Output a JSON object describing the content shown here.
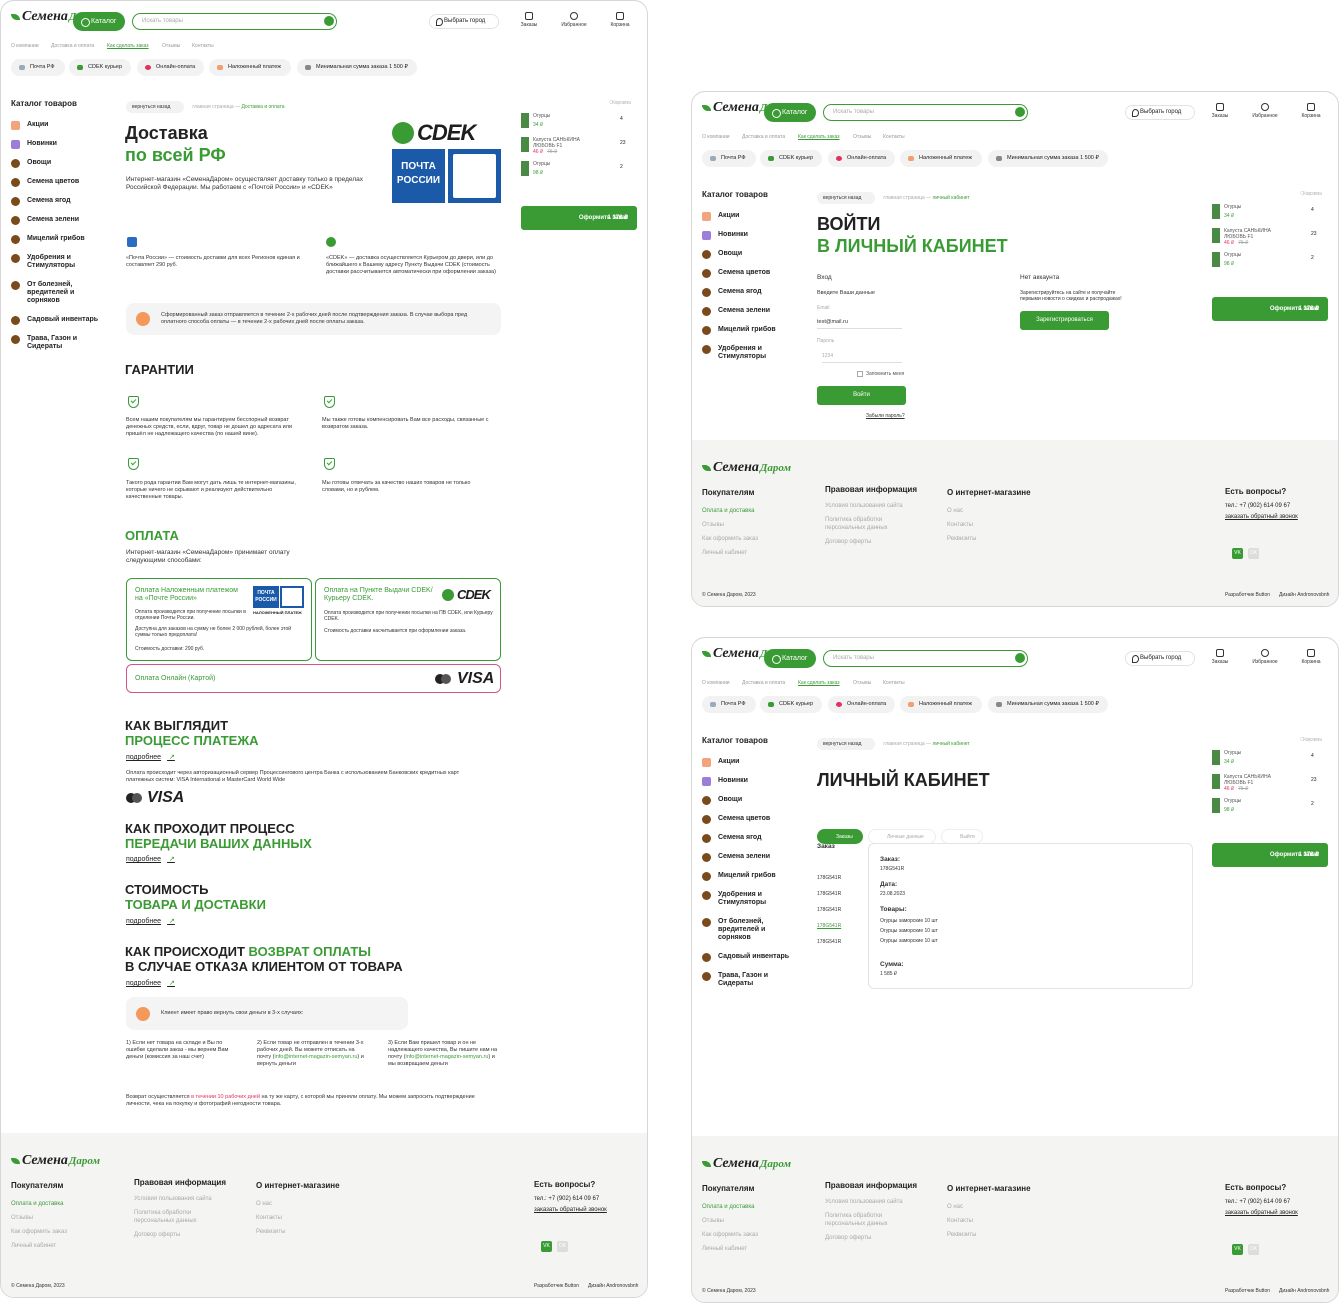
{
  "header": {
    "logo_main": "Семена",
    "logo_sub": "Даром",
    "catalog": "Каталог",
    "search_placeholder": "Искать товары",
    "city": "Выбрать город",
    "orders": "Заказы",
    "favorites": "Избранное",
    "cart": "Корзина"
  },
  "nav": [
    "О компании",
    "Доставка и оплата",
    "Как сделать заказ",
    "Отзывы",
    "Контакты"
  ],
  "pills": [
    "Почта РФ",
    "CDEK курьер",
    "Онлайн-оплата",
    "Наложенный платеж",
    "Минимальная сумма заказа 1 500 ₽"
  ],
  "sidebar": {
    "title": "Каталог товаров",
    "items": [
      "Акции",
      "Новинки",
      "Овощи",
      "Семена цветов",
      "Семена ягод",
      "Семена зелени",
      "Мицелий грибов",
      "Удобрения и Стимуляторы",
      "От болезней, вредителей и сорняков",
      "Садовый инвентарь",
      "Трава, Газон и Сидераты"
    ]
  },
  "cart": {
    "title": "Корзина",
    "clear": "Очистить",
    "items": [
      {
        "name": "Огурцы",
        "price": "34 ₽",
        "qty": "4"
      },
      {
        "name": "Капуста САНЬКИНА ЛЮБОВЬ F1",
        "price": "46 ₽",
        "old": "75 ₽",
        "qty": "23"
      },
      {
        "name": "Огурцы",
        "price": "98 ₽",
        "qty": "2"
      }
    ],
    "order": "Оформить заказ",
    "total": "1 378 ₽"
  },
  "crumbs": {
    "back": "вернуться назад",
    "home": "главная страница",
    "delivery": "Доставка и оплата",
    "cabinet": "личный кабинет"
  },
  "delivery": {
    "title1": "Доставка",
    "title2": "по всей РФ",
    "intro": "Интернет-магазин «СеменаДаром» осуществляет доставку только в пределах Российской Федерации. Мы работаем с «Почтой России» и «CDEK»",
    "cdek_logo": "CDEK",
    "pochta_logo": "ПОЧТА РОССИИ",
    "pochta_text": "«Почта России» — стоимость доставки для всех Регионов единая и составляет 290 руб.",
    "cdek_text": "«CDEK» — доставка осуществляется Курьером до двери, или до ближайшего к Вашему адресу Пункту Выдачи CDEK (стоимость доставки рассчитывается автоматически при оформлении заказа)",
    "note": "Сформированный заказ отправляется в течение 2-х рабочих дней после подтверждения заказа. В случае выбора пред оплатного способа оплаты — в течение 2-х рабочих дней после оплаты заказа."
  },
  "guarantees": {
    "title": "ГАРАНТИИ",
    "items": [
      "Всем нашим покупателям мы гарантируем бесспорный возврат денежных средств, если, вдруг, товар не дошел до адресата или пришёл не надлежащего качества (по нашей вине).",
      "Мы также готовы компенсировать Вам все расходы, связанные с возвратом заказа.",
      "Такого рода гарантии Вам могут дать лишь те интернет-магазины, которые ничего не скрывают и реализуют действительно качественные товары.",
      "Мы готовы отвечать за качество наших товаров не только словами, но и рублем."
    ]
  },
  "payment": {
    "title": "ОПЛАТА",
    "intro": "Интернет-магазин «СеменаДаром» принимает оплату следующими способами:",
    "card1_title": "Оплата Наложенным платежом на «Почте России»",
    "card1_badge": "НАЛОЖЕННЫЙ ПЛАТЕЖ",
    "card1_p1": "Оплата производится при получение посылки в отделении Почты России.",
    "card1_p2": "Доступна для заказов на сумму не более 2 000 рублей, более этой суммы только предоплата!",
    "card1_cost": "Стоимость доставки: 290 руб.",
    "card2_title": "Оплата на Пункте Выдачи CDEK/Курьеру CDEK.",
    "card2_p1": "Оплата производится при получении посылки на ПВ CDEK, или Курьеру CDEK.",
    "card2_p2": "Стоимость доставки насчитывается при оформлении заказа.",
    "card3_title": "Оплата Онлайн (Картой)",
    "visa": "VISA"
  },
  "process": {
    "t1a": "КАК ВЫГЛЯДИТ",
    "t1b": "ПРОЦЕСС ПЛАТЕЖА",
    "more": "подробнее",
    "text": "Оплата происходит через авторизационный сервер Процессингового центра Банка с использованием Банковских кредитных карт платежных систем: VISA International и MasterCard World Wide",
    "t2a": "КАК ПРОХОДИТ ПРОЦЕСС",
    "t2b": "ПЕРЕДАЧИ ВАШИХ ДАННЫХ",
    "t3a": "СТОИМОСТЬ",
    "t3b": "ТОВАРА И ДОСТАВКИ",
    "t4a": "КАК ПРОИСХОДИТ ",
    "t4g": "ВОЗВРАТ ОПЛАТЫ",
    "t4b": "В СЛУЧАЕ ОТКАЗА КЛИЕНТОМ ОТ ТОВАРА",
    "note": "Клиент имеет право вернуть свои деньги в 3-х случаях:",
    "c1": "1) Если нет товара на складе и Вы по ошибке сделали заказ - мы вернем Вам деньги (комиссия за наш счет)",
    "c2a": "2) Если товар не отправлен в течении 3-х рабочих дней. Вы можете отписать на почту (",
    "c2l": "info@internet-magazin-semyan.ru",
    "c2b": ") и вернуть деньги",
    "c3a": "3) Если Вам пришел товар и он не надлежащего качества, Вы пишите нам на почту (",
    "c3l": "info@internet-magazin-semyan.ru",
    "c3b": ") и мы возвращаем деньги",
    "fin_a": "Возврат осуществляется ",
    "fin_r": "в течении 10 рабочих дней",
    "fin_b": " на ту же карту, с которой мы приняли оплату. Мы можем запросить подтверждение личности, чека на покупку и фотографий негодности товара."
  },
  "footer": {
    "c1_title": "Покупателям",
    "c1": [
      "Оплата и доставка",
      "Отзывы",
      "Как оформить заказ",
      "Личный кабинет"
    ],
    "c2_title": "Правовая информация",
    "c2": [
      "Условия пользования сайта",
      "Политика обработки персональных данных",
      "Договор оферты"
    ],
    "c3_title": "О интернет-магазине",
    "c3": [
      "О нас",
      "Контакты",
      "Реквизиты"
    ],
    "c4_title": "Есть вопросы?",
    "phone": "тел.: +7 (902) 614 09 67",
    "callback": "заказать обратный звонок",
    "vk": "VK",
    "ok": "OK",
    "copy": "© Семена Даром, 2023",
    "dev": "Разработчик Button",
    "design": "Дизайн Andronovsbnh"
  },
  "login": {
    "t1": "ВОЙТИ",
    "t2": "В ЛИЧНЫЙ КАБИНЕТ",
    "enter": "Вход",
    "hint": "Введите Ваши данные",
    "email_label": "Email",
    "email": "test@mail.ru",
    "pass_label": "Пароль",
    "pass": "1234",
    "remember": "Запомнить меня",
    "btn": "Войти",
    "forgot": "Забыли пароль?",
    "no_acc": "Нет аккаунта",
    "reg_text": "Зарегистрируйтесь на сайте и получайте первыми новости о скидках и распродажах!",
    "reg_btn": "Зарегистрироваться"
  },
  "cabinet": {
    "title": "ЛИЧНЫЙ КАБИНЕТ",
    "tabs": [
      "Заказы",
      "Личные данные",
      "Выйти"
    ],
    "col": "Заказ",
    "orders": [
      "178G541R",
      "178G541R",
      "178G541R",
      "178G541R",
      "178G541R"
    ],
    "l_order": "Заказ:",
    "v_order": "178G541R",
    "l_date": "Дата:",
    "v_date": "23.08.2023",
    "l_goods": "Товары:",
    "goods": [
      "Огурцы заморские 10 шт",
      "Огурцы заморские 10 шт",
      "Огурцы заморские 10 шт"
    ],
    "l_sum": "Сумма:",
    "v_sum": "1 585 ₽"
  }
}
